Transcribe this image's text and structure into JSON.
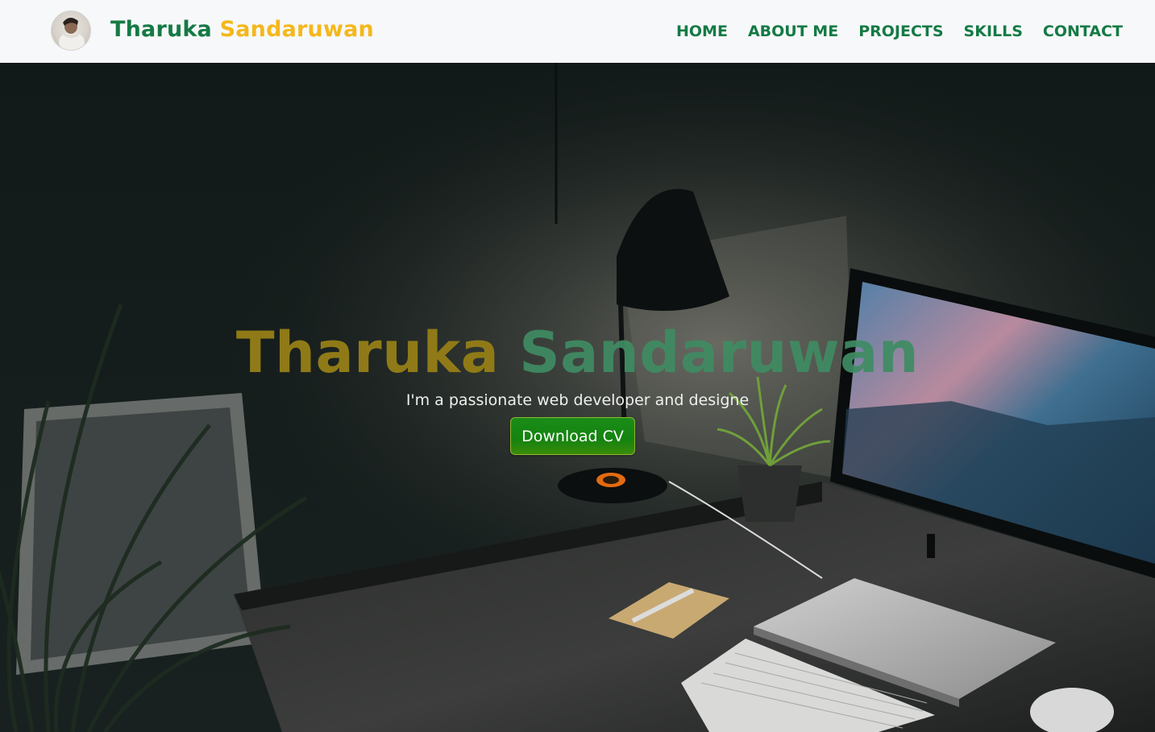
{
  "navbar": {
    "brand_first": "Tharuka",
    "brand_last": "Sandaruwan",
    "links": [
      "HOME",
      "ABOUT ME",
      "PROJECTS",
      "SKILLS",
      "CONTACT"
    ]
  },
  "hero": {
    "title_first": "Tharuka",
    "title_last": "Sandaruwan",
    "subtitle": "I'm a passionate web developer and designe",
    "cv_button": "Download CV"
  },
  "colors": {
    "brand_green": "#157a45",
    "brand_yellow": "#f4b81c",
    "hero_gold": "#8f7a17",
    "hero_green": "#3f8c63",
    "button_green": "#158310"
  },
  "icons": [
    "avatar-photo"
  ]
}
